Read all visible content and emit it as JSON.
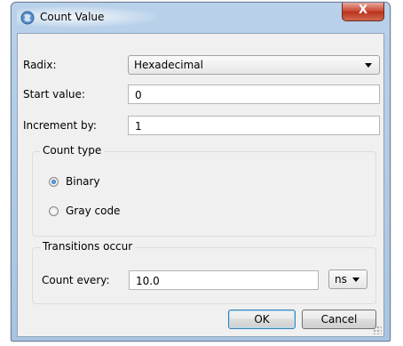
{
  "window": {
    "title": "Count Value",
    "close_glyph": "X"
  },
  "form": {
    "radix_label": "Radix:",
    "radix_value": "Hexadecimal",
    "start_label": "Start value:",
    "start_value": "0",
    "increment_label": "Increment by:",
    "increment_value": "1"
  },
  "count_type": {
    "legend": "Count type",
    "options": [
      {
        "label": "Binary",
        "selected": true
      },
      {
        "label": "Gray code",
        "selected": false
      }
    ]
  },
  "transitions": {
    "legend": "Transitions occur",
    "count_every_label": "Count every:",
    "count_every_value": "10.0",
    "unit_value": "ns"
  },
  "buttons": {
    "ok": "OK",
    "cancel": "Cancel"
  },
  "colors": {
    "title_bar": "#b9d1ea",
    "close_button": "#c7432d",
    "dialog_bg": "#f0f0f0",
    "default_button_border": "#3c7fb1"
  }
}
